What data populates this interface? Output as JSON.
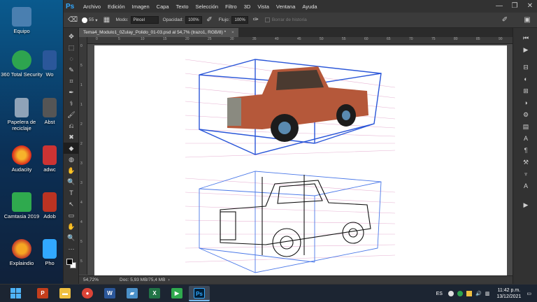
{
  "desktop": {
    "icons": [
      {
        "label": "Equipo",
        "color": "#4a7fb0"
      },
      {
        "label": "360 Total Security",
        "color": "#2ea44f"
      },
      {
        "label": "Papelera de reciclaje",
        "color": "#8fa3b8"
      },
      {
        "label": "Audacity",
        "color": "#e8871a"
      },
      {
        "label": "Camtasia 2019",
        "color": "#2faa4e"
      },
      {
        "label": "Explaindio",
        "color": "#d94030"
      }
    ],
    "partial_icons": [
      {
        "label": "Wo",
        "color": "#2b579a"
      },
      {
        "label": "Abst",
        "color": "#555"
      },
      {
        "label": "adwc",
        "color": "#c33"
      },
      {
        "label": "Adob",
        "color": "#b32"
      },
      {
        "label": "Pho",
        "color": "#31a8ff"
      }
    ]
  },
  "photoshop": {
    "logo": "Ps",
    "menu": [
      "Archivo",
      "Edición",
      "Imagen",
      "Capa",
      "Texto",
      "Selección",
      "Filtro",
      "3D",
      "Vista",
      "Ventana",
      "Ayuda"
    ],
    "window_controls": {
      "minimize": "—",
      "maximize": "❐",
      "close": "✕"
    },
    "options": {
      "brush_size": "55",
      "mode_label": "Modo:",
      "mode_value": "Pincel",
      "opacity_label": "Opacidad:",
      "opacity_value": "100%",
      "flow_label": "Flujo:",
      "flow_value": "100%",
      "history_label": "Borrar de historia"
    },
    "document_tab": {
      "title": "Tema4_Modulo1_0Zulay_Polido_01-03.psd al 54,7% (trazo1, RGB/8) *",
      "close": "×"
    },
    "ruler_top_ticks": [
      "0",
      "5",
      "10",
      "15",
      "20",
      "25",
      "30",
      "35",
      "40",
      "45",
      "50",
      "55",
      "60",
      "65",
      "70",
      "75",
      "80",
      "85",
      "90"
    ],
    "ruler_left_ticks": [
      "0",
      "5",
      "1",
      "1",
      "2",
      "2",
      "3",
      "3",
      "4",
      "4",
      "5",
      "5"
    ],
    "status": {
      "zoom": "54,72%",
      "doc": "Doc: 5,93 MB/75,4 MB"
    },
    "tools": [
      "✥",
      "⬚",
      "◌",
      "✎",
      "⌗",
      "✒",
      "⚕",
      "🖌",
      "⎌",
      "✖",
      "◆",
      "◍",
      "✋",
      "🔍",
      "T",
      "↖",
      "▭",
      "✋",
      "🔍",
      "⋯"
    ],
    "panel_icons": [
      "⏮",
      "▶",
      "⊟",
      "◐",
      "⊞",
      "◑",
      "⚙",
      "▤",
      "A",
      "¶",
      "⚒",
      "♆",
      "A",
      "▶"
    ]
  },
  "taskbar": {
    "apps": [
      {
        "name": "powerpoint",
        "glyph": "P",
        "color": "#c43e1c"
      },
      {
        "name": "file-explorer",
        "glyph": "▬",
        "color": "#f0c040"
      },
      {
        "name": "chrome",
        "glyph": "●",
        "color": "#db4437"
      },
      {
        "name": "word",
        "glyph": "W",
        "color": "#2b579a"
      },
      {
        "name": "notes",
        "glyph": "▰",
        "color": "#4a90c8"
      },
      {
        "name": "excel",
        "glyph": "X",
        "color": "#217346"
      },
      {
        "name": "camtasia",
        "glyph": "▶",
        "color": "#2faa4e"
      },
      {
        "name": "photoshop",
        "glyph": "Ps",
        "color": "#001e36"
      }
    ],
    "tray": {
      "language": "ES",
      "time": "11:42 p.m.",
      "date": "13/12/2021"
    }
  }
}
